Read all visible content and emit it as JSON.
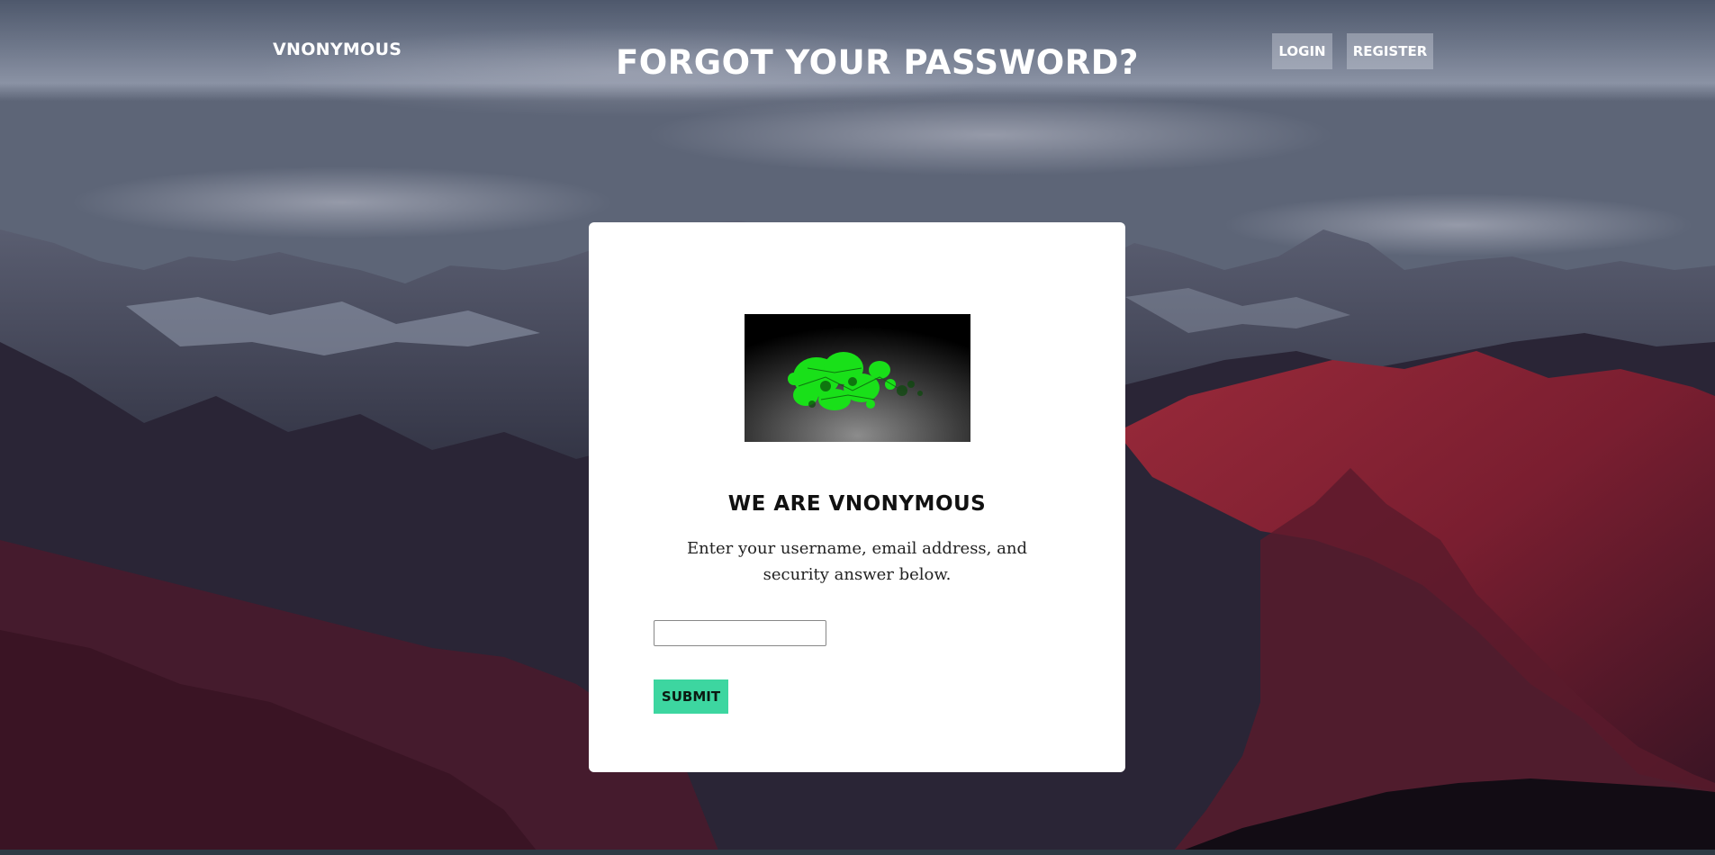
{
  "header": {
    "brand": "VNONYMOUS",
    "title": "FORGOT YOUR PASSWORD?",
    "login_label": "LOGIN",
    "register_label": "REGISTER"
  },
  "card": {
    "logo_icon": "green-network-graph-logo",
    "heading": "WE ARE VNONYMOUS",
    "description": "Enter your username, email address, and security answer below.",
    "input_value": "",
    "submit_label": "SUBMIT"
  },
  "colors": {
    "submit_bg": "#3dd6a0",
    "logo_green": "#19e019",
    "nav_button_bg": "rgba(200,205,215,0.45)"
  }
}
